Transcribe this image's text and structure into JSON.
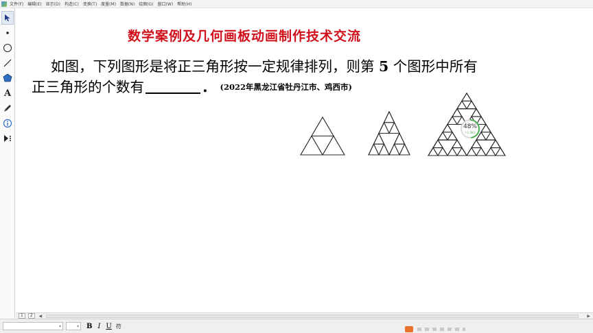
{
  "menu": [
    "文件(F)",
    "编辑(E)",
    "显示(D)",
    "构造(C)",
    "变换(T)",
    "度量(M)",
    "数据(N)",
    "绘图(G)",
    "窗口(W)",
    "帮助(H)"
  ],
  "toolbox": {
    "tools": [
      "arrow-select-icon",
      "point-icon",
      "circle-compass-icon",
      "line-straightedge-icon",
      "polygon-icon",
      "text-icon",
      "marker-icon",
      "information-icon",
      "custom-tool-icon"
    ],
    "text_tool_label": "A"
  },
  "title": "数学案例及几何画板动画制作技术交流",
  "question": {
    "line1_before": "如图，下列图形是将正三角形按一定规律排列，则第 ",
    "line1_num": "5",
    "line1_after": " 个图形中所有",
    "line2_start": "正三角形的个数有",
    "line2_end": "．",
    "source": "(2022年黑龙江省牡丹江市、鸡西市)"
  },
  "figures": [
    {
      "level": 1
    },
    {
      "level": 2
    },
    {
      "level": 3
    }
  ],
  "progress": {
    "value": "48%",
    "sub": "↑1.3K/s",
    "fraction": 0.48,
    "color": "#4caf50"
  },
  "page_tabs": {
    "tab1": "1",
    "tab2": "2"
  },
  "text_toolbar": {
    "bold": "B",
    "italic": "I",
    "underline": "U",
    "symbol": "符"
  },
  "colors": {
    "title": "#d0101b",
    "accent": "#4caf50"
  }
}
